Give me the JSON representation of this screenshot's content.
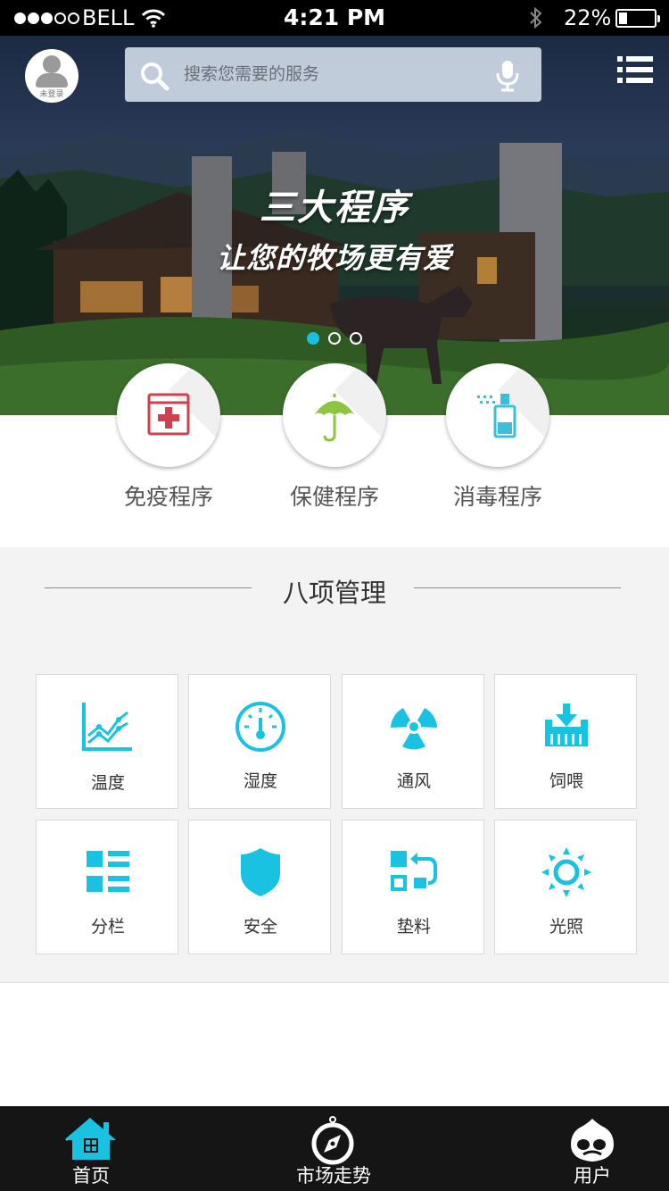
{
  "status_bar": {
    "carrier": "BELL",
    "signal_bars_filled": 3,
    "signal_bars_total": 5,
    "time": "4:21 PM",
    "battery": "22%",
    "battery_level": 0.22
  },
  "header": {
    "avatar_label": "未登录",
    "search_placeholder": "搜索您需要的服务",
    "icons": [
      "avatar-icon",
      "search-icon",
      "microphone-icon",
      "menu-list-icon"
    ]
  },
  "banner": {
    "title": "三大程序",
    "subtitle": "让您的牧场更有爱",
    "slides_total": 3,
    "active_slide": 1
  },
  "programs": [
    {
      "label": "免疫程序",
      "icon": "medical-kit-icon",
      "color": "#d0414f"
    },
    {
      "label": "保健程序",
      "icon": "umbrella-icon",
      "color": "#8cc63f"
    },
    {
      "label": "消毒程序",
      "icon": "spray-bottle-icon",
      "color": "#3cbed8"
    }
  ],
  "management": {
    "title": "八项管理",
    "accent_color": "#18c2e0",
    "items": [
      {
        "label": "温度",
        "icon": "line-chart-icon"
      },
      {
        "label": "湿度",
        "icon": "gauge-icon"
      },
      {
        "label": "通风",
        "icon": "radiation-fan-icon"
      },
      {
        "label": "饲喂",
        "icon": "feed-trough-icon"
      },
      {
        "label": "分栏",
        "icon": "list-grid-icon"
      },
      {
        "label": "安全",
        "icon": "shield-icon"
      },
      {
        "label": "垫料",
        "icon": "swap-blocks-icon"
      },
      {
        "label": "光照",
        "icon": "sun-icon"
      }
    ]
  },
  "tab_bar": {
    "tabs": [
      {
        "label": "首页",
        "icon": "home-icon",
        "active": true
      },
      {
        "label": "市场走势",
        "icon": "compass-icon",
        "active": false
      },
      {
        "label": "用户",
        "icon": "user-face-icon",
        "active": false
      }
    ],
    "active_color": "#18c2e0"
  }
}
